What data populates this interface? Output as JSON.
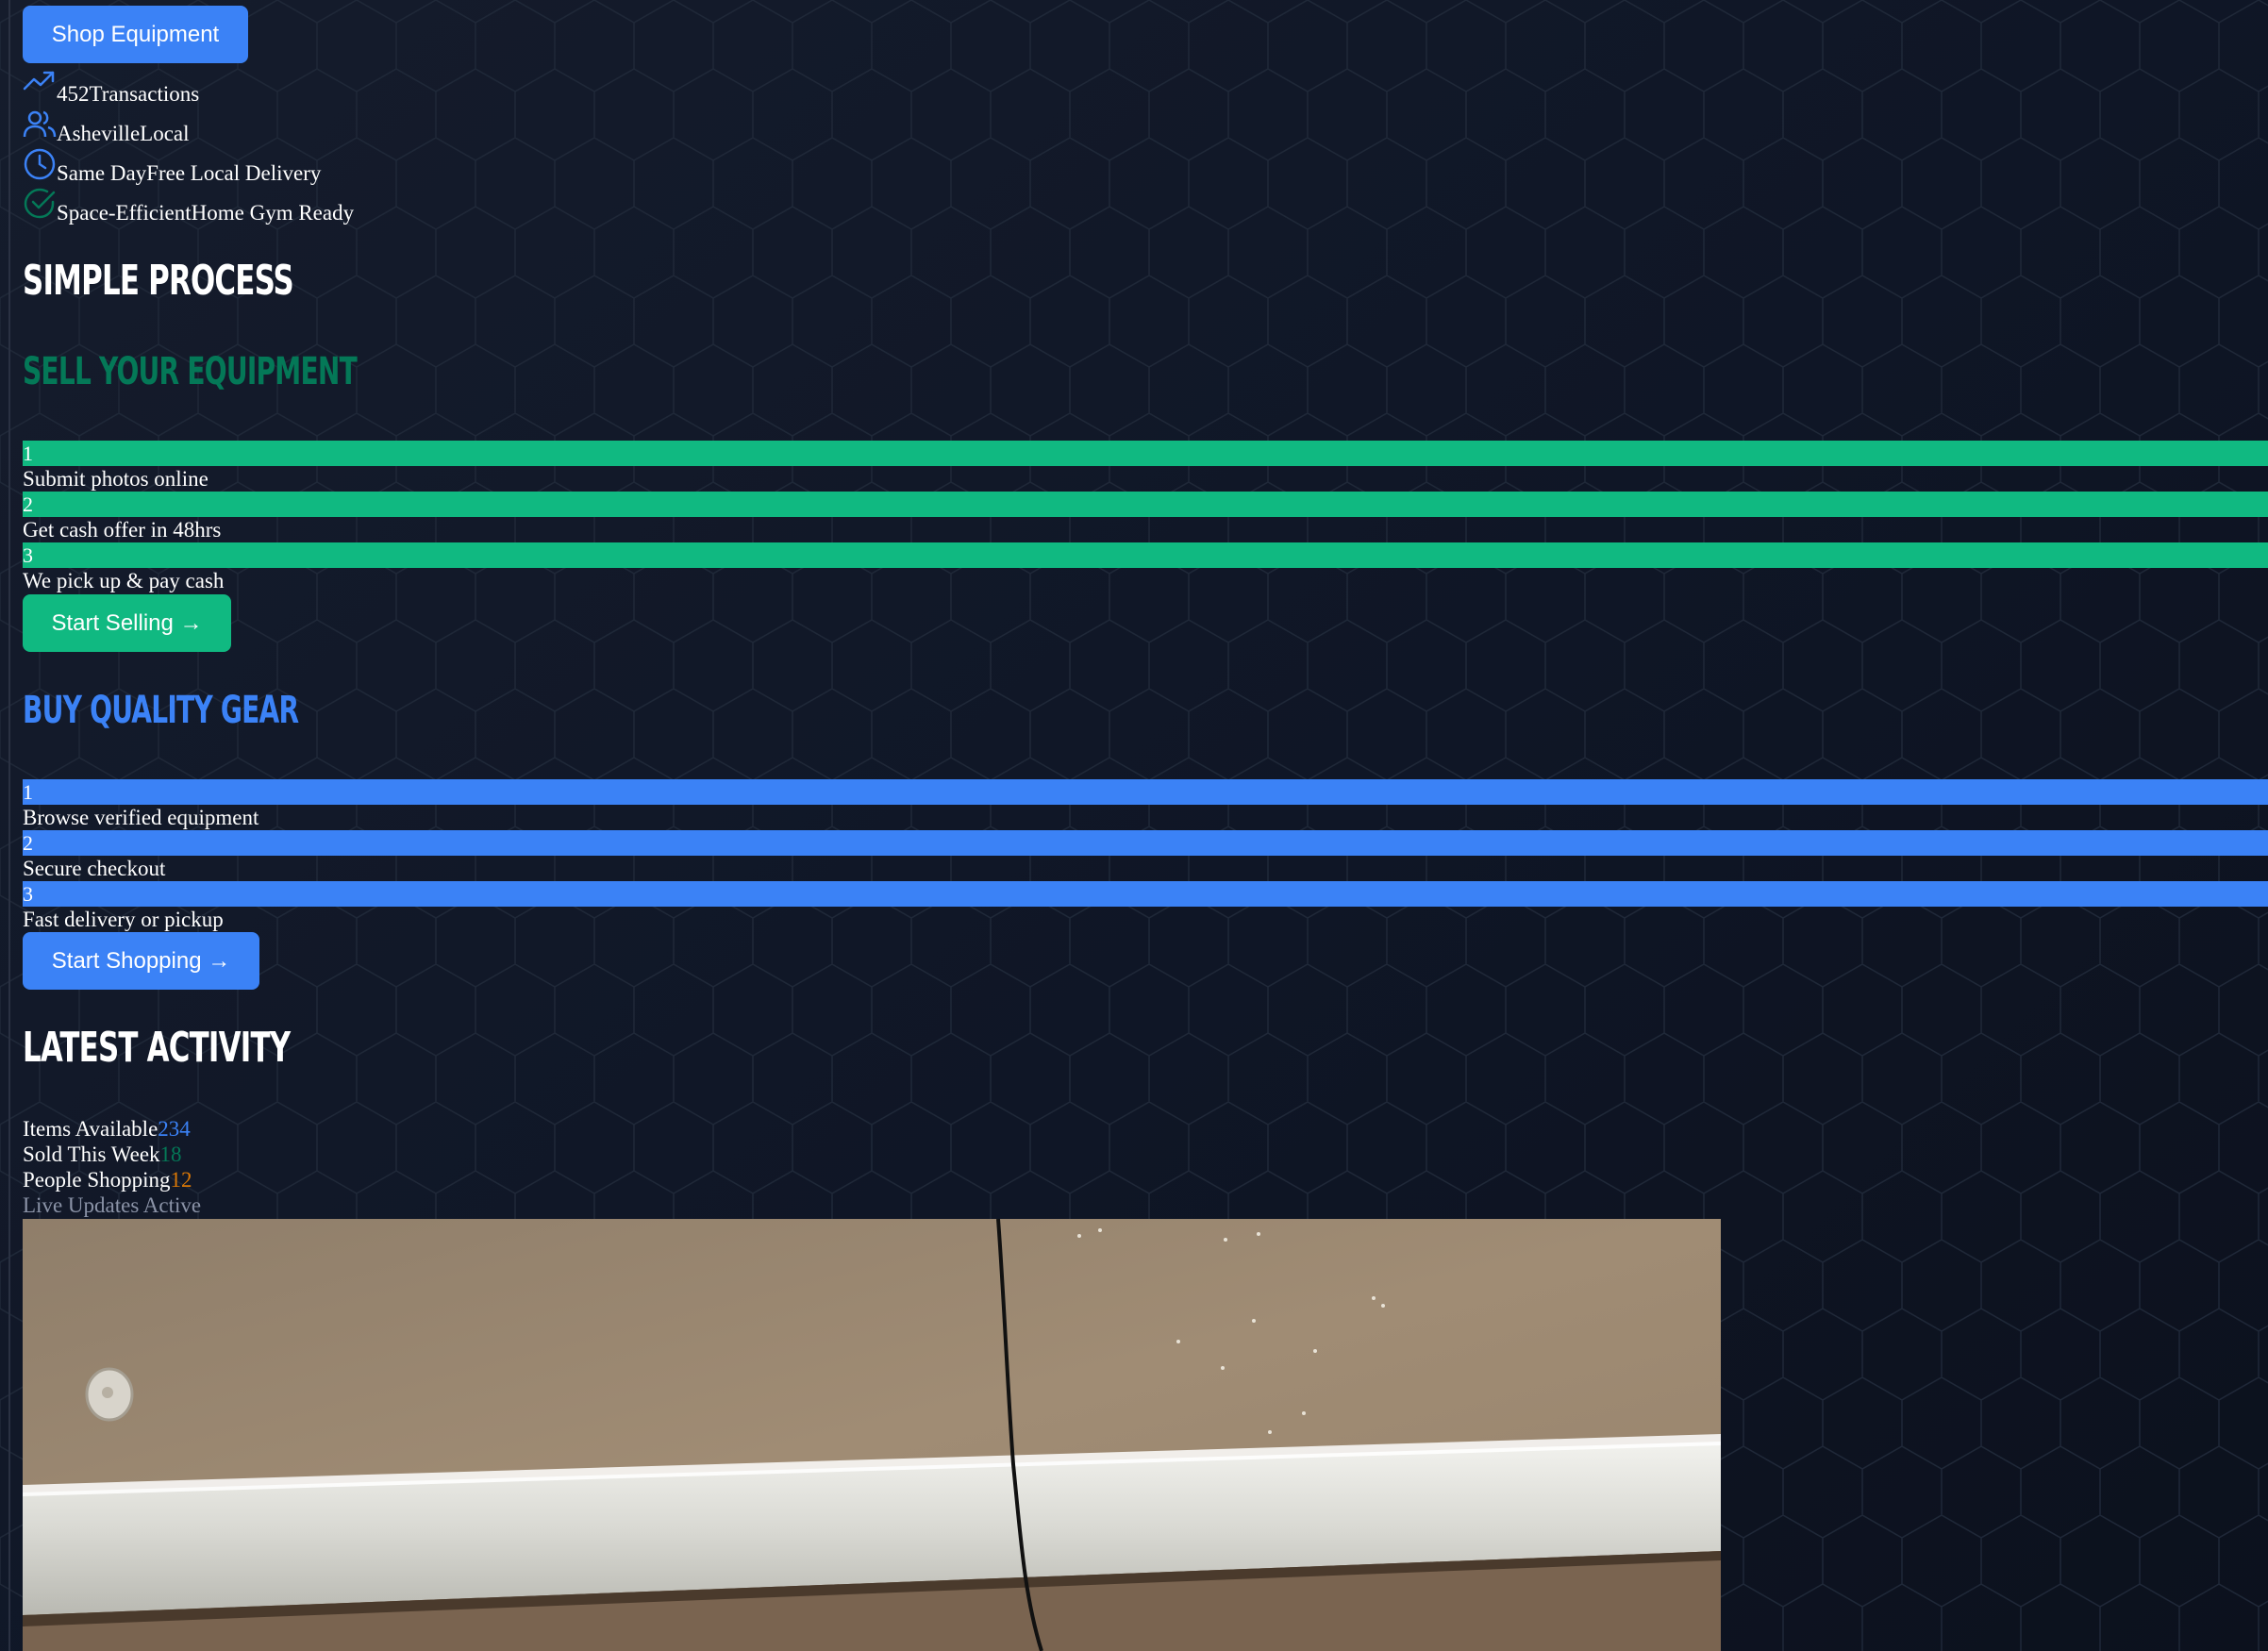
{
  "shop_button": {
    "label": "Shop Equipment"
  },
  "stats": [
    {
      "icon": "trending-up-icon",
      "value": "452",
      "label": "Transactions"
    },
    {
      "icon": "users-icon",
      "value": "Asheville",
      "label": "Local"
    },
    {
      "icon": "clock-icon",
      "value": "Same Day",
      "label": "Free Local Delivery"
    },
    {
      "icon": "check-circle-icon",
      "value": "Space-Efficient",
      "label": "Home Gym Ready"
    }
  ],
  "process": {
    "title": "Simple Process",
    "sell": {
      "title": "Sell Your Equipment",
      "steps": [
        {
          "num": "1",
          "text": "Submit photos online"
        },
        {
          "num": "2",
          "text": "Get cash offer in 48hrs"
        },
        {
          "num": "3",
          "text": "We pick up & pay cash"
        }
      ],
      "button": "Start Selling →"
    },
    "buy": {
      "title": "Buy Quality Gear",
      "steps": [
        {
          "num": "1",
          "text": "Browse verified equipment"
        },
        {
          "num": "2",
          "text": "Secure checkout"
        },
        {
          "num": "3",
          "text": "Fast delivery or pickup"
        }
      ],
      "button": "Start Shopping →"
    }
  },
  "activity": {
    "title": "Latest Activity",
    "items": [
      {
        "label": "Items Available",
        "value": "234"
      },
      {
        "label": "Sold This Week",
        "value": "18"
      },
      {
        "label": "People Shopping",
        "value": "12"
      }
    ],
    "live": "Live Updates Active"
  },
  "colors": {
    "blue": "#3b82f6",
    "green": "#10b981",
    "dark_green": "#047857",
    "amber": "#d97706",
    "background": "#121a2b"
  }
}
